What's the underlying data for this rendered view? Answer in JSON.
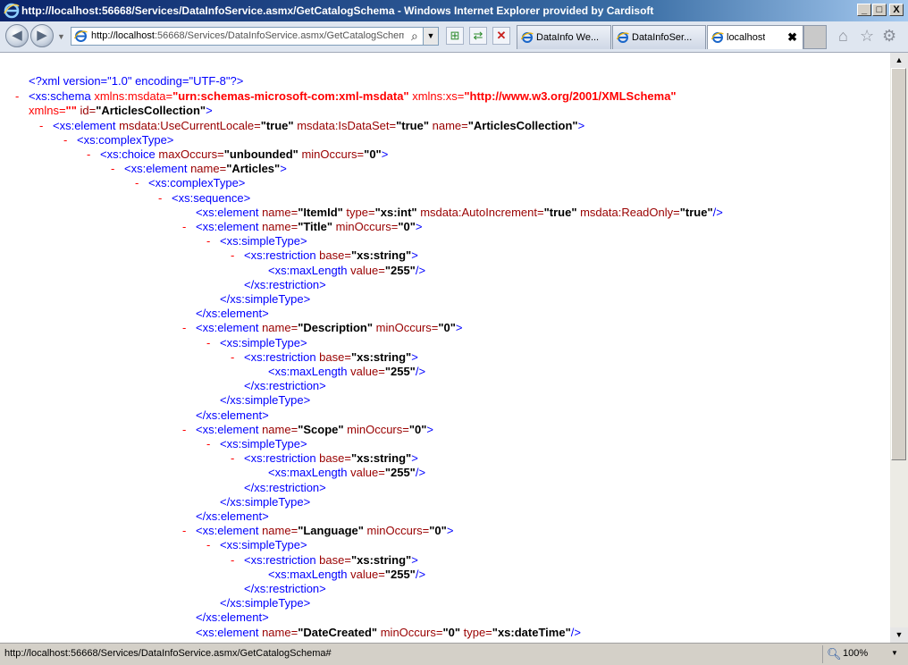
{
  "window": {
    "title": "http://localhost:56668/Services/DataInfoService.asmx/GetCatalogSchema - Windows Internet Explorer provided by Cardisoft",
    "min_label": "_",
    "max_label": "□",
    "close_label": "X"
  },
  "nav": {
    "back_glyph": "◀",
    "forward_glyph": "▶",
    "dropdown_glyph": "▼",
    "address_host": "http://localhost",
    "address_rest": ":56668/Services/DataInfoService.asmx/GetCatalogSchem",
    "search_glyph": "⌕",
    "compat_glyph": "⊞",
    "refresh_glyph": "⇄",
    "stop_glyph": "✕"
  },
  "tabs": [
    {
      "label": "DataInfo We...",
      "active": false
    },
    {
      "label": "DataInfoSer...",
      "active": false
    },
    {
      "label": "localhost",
      "active": true,
      "close": "✖"
    }
  ],
  "command_icons": {
    "home": "⌂",
    "favorites": "☆",
    "tools": "⚙"
  },
  "xml": {
    "decl_open": "<?xml version=",
    "decl_version": "\"1.0\"",
    "decl_enc_attr": " encoding=",
    "decl_enc": "\"UTF-8\"",
    "decl_close": "?>",
    "minus": "-",
    "schema_open": "<xs:schema",
    "xmlns_msdata_attr": " xmlns:msdata=",
    "xmlns_msdata_val": "\"urn:schemas-microsoft-com:xml-msdata\"",
    "xmlns_xs_attr": " xmlns:xs=",
    "xmlns_xs_val": "\"http://www.w3.org/2001/XMLSchema\"",
    "xmlns_attr": "xmlns=",
    "xmlns_val": "\"\"",
    "id_attr": " id=",
    "id_val": "\"ArticlesCollection\"",
    "gt": ">",
    "sgt": "/>",
    "el_open": "<xs:element",
    "el_close": "</xs:element>",
    "use_current_locale_attr": " msdata:UseCurrentLocale=",
    "use_current_locale_val": "\"true\"",
    "is_dataset_attr": " msdata:IsDataSet=",
    "is_dataset_val": "\"true\"",
    "name_attr": " name=",
    "collection_name": "\"ArticlesCollection\"",
    "complex_open": "<xs:complexType>",
    "choice_open": "<xs:choice",
    "max_occurs_attr": " maxOccurs=",
    "max_occurs_val": "\"unbounded\"",
    "min_occurs_attr": " minOccurs=",
    "zero": "\"0\"",
    "articles_name": "\"Articles\"",
    "sequence_open": "<xs:sequence>",
    "type_attr": " type=",
    "xs_int": "\"xs:int\"",
    "auto_inc_attr": " msdata:AutoIncrement=",
    "readonly_attr": " msdata:ReadOnly=",
    "true_val": "\"true\"",
    "simple_open": "<xs:simpleType>",
    "simple_close": "</xs:simpleType>",
    "restriction_open": "<xs:restriction",
    "base_attr": " base=",
    "xs_string": "\"xs:string\"",
    "restriction_close": "</xs:restriction>",
    "maxlength_open": "<xs:maxLength",
    "value_attr": " value=",
    "len_255": "\"255\"",
    "xs_datetime": "\"xs:dateTime\"",
    "field_itemid": "\"ItemId\"",
    "field_title": "\"Title\"",
    "field_description": "\"Description\"",
    "field_scope": "\"Scope\"",
    "field_language": "\"Language\"",
    "field_datecreated": "\"DateCreated\""
  },
  "status": {
    "text": "http://localhost:56668/Services/DataInfoService.asmx/GetCatalogSchema#",
    "zoom": "100%",
    "zoom_drop": "▼"
  },
  "scrollbar": {
    "up": "▲",
    "down": "▼"
  },
  "colors": {
    "tag": "#0000ff",
    "attr_name": "#990000",
    "attr_value": "#000000",
    "ns": "#ff0000",
    "minus": "#ff0000"
  }
}
